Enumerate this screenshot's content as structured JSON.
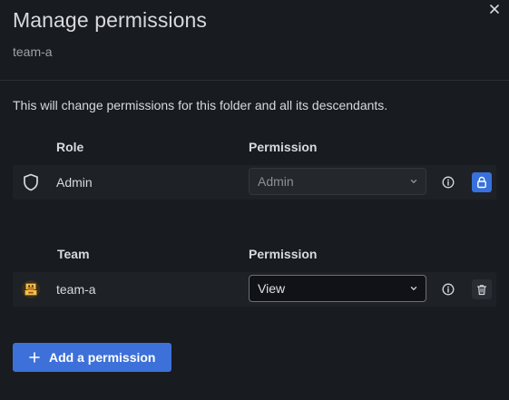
{
  "dialog": {
    "title": "Manage permissions",
    "subtitle": "team-a",
    "close_icon": "close-icon",
    "description": "This will change permissions for this folder and all its descendants."
  },
  "role_section": {
    "header_role": "Role",
    "header_permission": "Permission",
    "rows": [
      {
        "icon": "shield-icon",
        "label": "Admin",
        "permission": "Admin",
        "permission_disabled": true,
        "action_icon": "lock-icon"
      }
    ]
  },
  "team_section": {
    "header_team": "Team",
    "header_permission": "Permission",
    "rows": [
      {
        "icon": "team-avatar",
        "label": "team-a",
        "permission": "View",
        "permission_disabled": false,
        "action_icon": "trash-icon"
      }
    ]
  },
  "add_button": {
    "label": "Add a permission",
    "icon": "plus-icon"
  },
  "colors": {
    "background": "#181b1f",
    "row_background": "#1e2126",
    "primary": "#3d71d9",
    "text": "#d8d9e0",
    "muted_text": "#9fa1aa"
  }
}
